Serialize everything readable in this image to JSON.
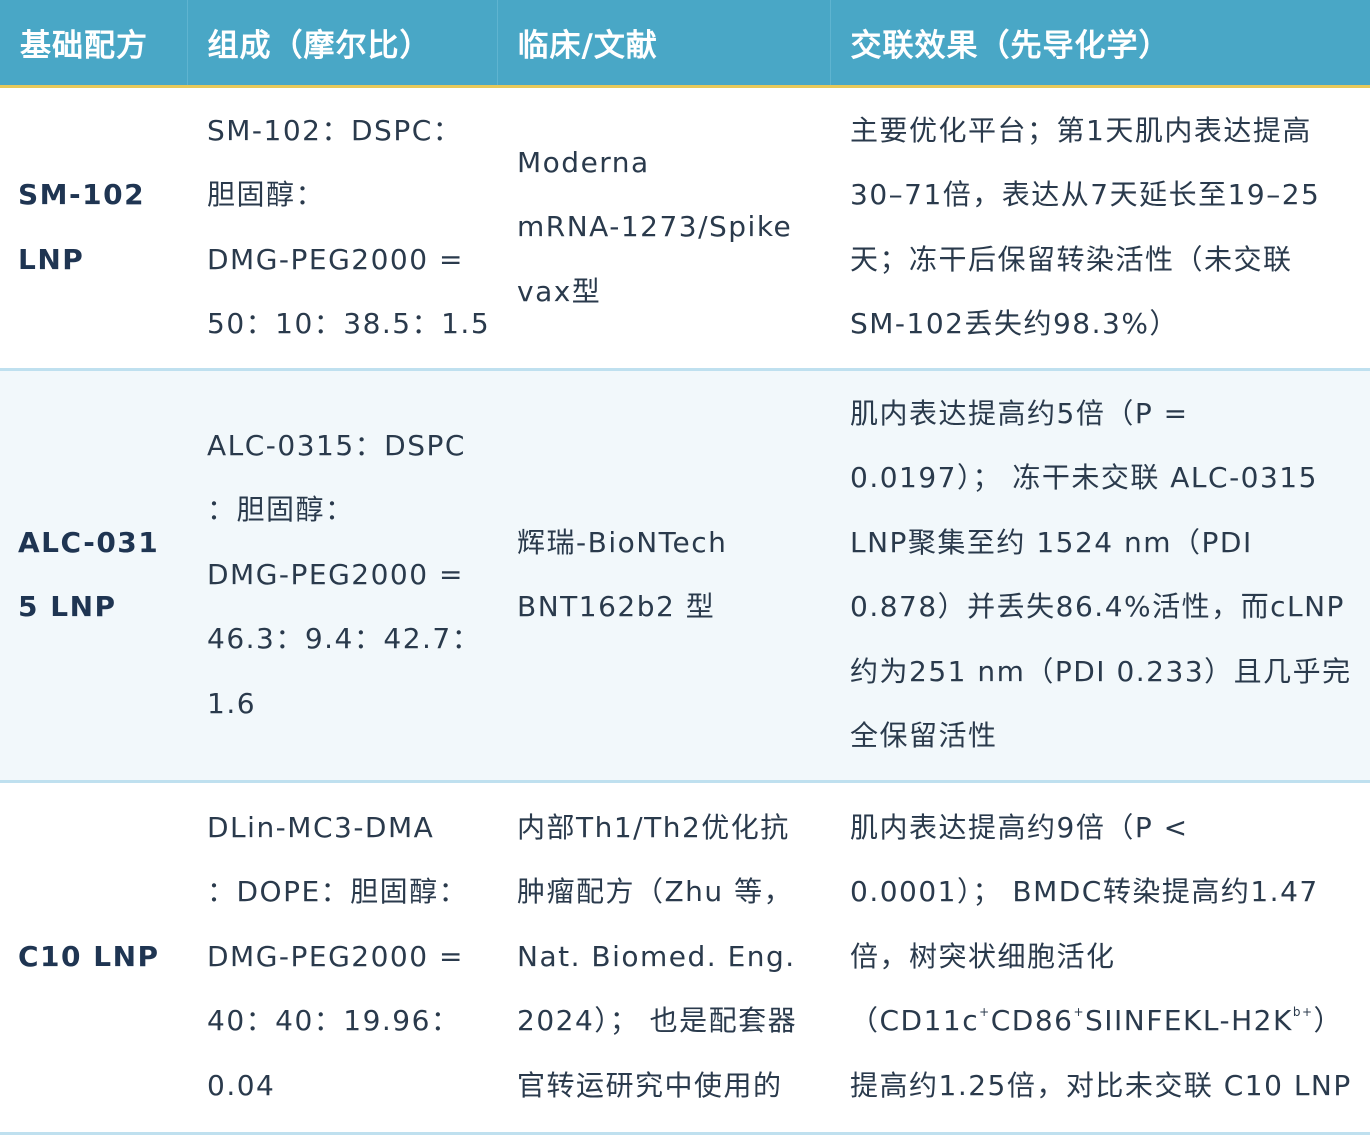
{
  "table": {
    "headers": [
      "基础配方",
      "组成（摩尔比）",
      "临床/文献",
      "交联效果（先导化学）"
    ],
    "rows": [
      {
        "base": [
          "SM-102",
          "LNP"
        ],
        "composition": [
          "SM-102：DSPC：",
          "胆固醇：",
          "DMG-PEG2000 =",
          "50：10：38.5：1.5"
        ],
        "clinical": [
          "Moderna",
          "mRNA-1273/Spike",
          "vax型"
        ],
        "effect": [
          "主要优化平台；第1天肌内表达提高",
          "30–71倍，表达从7天延长至19–25",
          "天；冻干后保留转染活性（未交联",
          "SM-102丢失约98.3%）"
        ]
      },
      {
        "base": [
          "ALC-031",
          "5 LNP"
        ],
        "composition": [
          "ALC-0315：DSPC",
          "：胆固醇：",
          "DMG-PEG2000 =",
          "46.3：9.4：42.7：",
          "1.6"
        ],
        "clinical": [
          "辉瑞-BioNTech",
          "BNT162b2 型"
        ],
        "effect": [
          "肌内表达提高约5倍（P =",
          "0.0197）； 冻干未交联 ALC-0315",
          "LNP聚集至约 1524 nm（PDI",
          "0.878）并丢失86.4%活性，而cLNP",
          "约为251 nm（PDI 0.233）且几乎完",
          "全保留活性"
        ]
      },
      {
        "base": [
          "C10 LNP"
        ],
        "composition": [
          "DLin-MC3-DMA",
          "：DOPE：胆固醇：",
          "DMG-PEG2000 =",
          "40：40：19.96：",
          "0.04"
        ],
        "clinical": [
          "内部Th1/Th2优化抗",
          "肿瘤配方（Zhu 等，",
          "Nat. Biomed. Eng.",
          "2024）； 也是配套器",
          "官转运研究中使用的"
        ],
        "effect": [
          "肌内表达提高约9倍（P <",
          "0.0001）； BMDC转染提高约1.47",
          "倍，树突状细胞活化"
        ],
        "effect_marker": {
          "prefix": "（CD11c",
          "sup1": "+",
          "mid1": "CD86",
          "sup2": "+",
          "mid2": "SIINFEKL-H2K",
          "sup3": "b+",
          "suffix": "）"
        },
        "effect_tail": "提高约1.25倍，对比未交联 C10 LNP"
      }
    ]
  }
}
